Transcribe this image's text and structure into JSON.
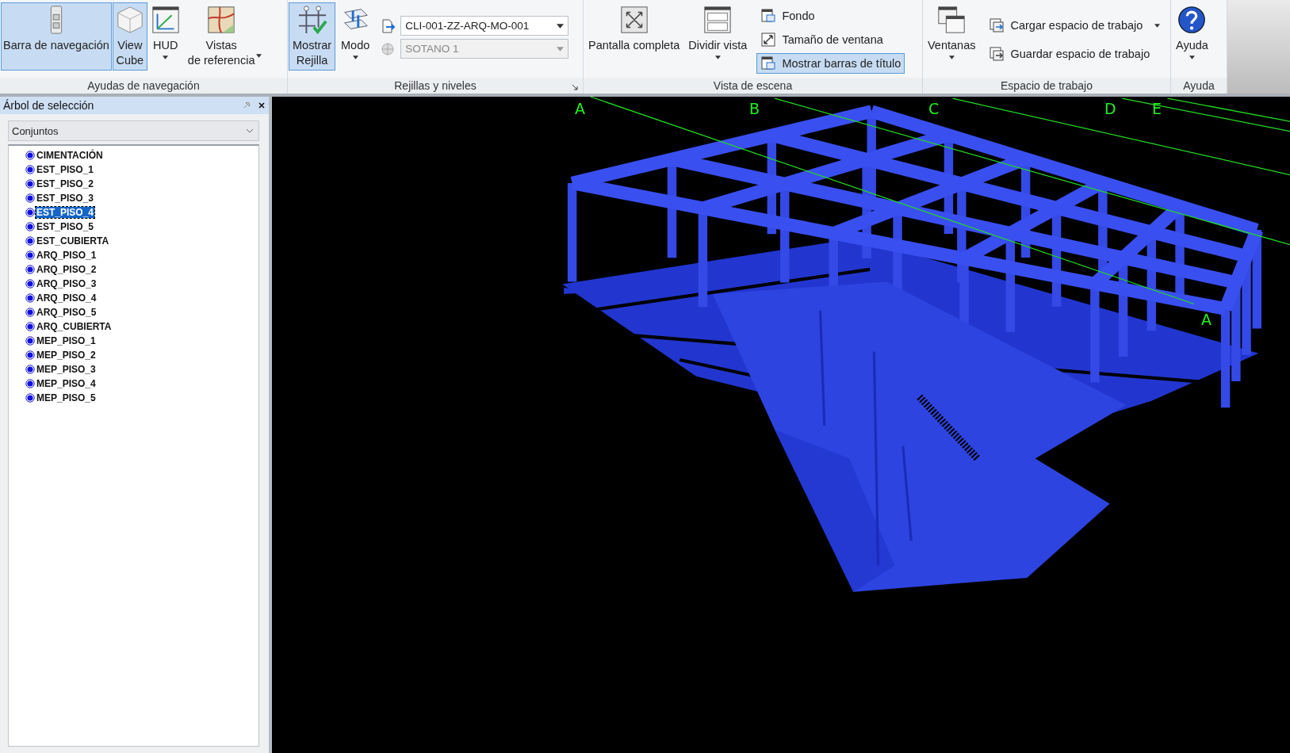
{
  "ribbon": {
    "groups": [
      {
        "label": "Ayudas de navegación",
        "large": [
          {
            "lines": [
              "Barra de navegación"
            ],
            "selected": true,
            "dropdown": false
          },
          {
            "lines": [
              "View",
              "Cube"
            ],
            "selected": true,
            "dropdown": false
          },
          {
            "lines": [
              "HUD"
            ],
            "selected": false,
            "dropdown": true
          },
          {
            "lines": [
              "Vistas",
              "de referencia"
            ],
            "selected": false,
            "dropdown": true
          }
        ]
      },
      {
        "label": "Rejillas y niveles",
        "launcher": true,
        "large": [
          {
            "lines": [
              "Mostrar",
              "Rejilla"
            ],
            "selected": true,
            "dropdown": false
          },
          {
            "lines": [
              "Modo"
            ],
            "selected": false,
            "dropdown": true
          }
        ],
        "combos": [
          {
            "value": "CLI-001-ZZ-ARQ-MO-001",
            "disabled": false
          },
          {
            "value": "SOTANO 1",
            "disabled": true
          }
        ]
      },
      {
        "label": "Vista de escena",
        "large": [
          {
            "lines": [
              "Pantalla completa"
            ],
            "selected": false,
            "dropdown": false
          },
          {
            "lines": [
              "Dividir vista"
            ],
            "selected": false,
            "dropdown": true
          }
        ],
        "small": [
          {
            "label": "Fondo",
            "selected": false,
            "dropdown": false
          },
          {
            "label": "Tamaño de ventana",
            "selected": false,
            "dropdown": false
          },
          {
            "label": "Mostrar barras de título",
            "selected": true,
            "dropdown": false
          }
        ]
      },
      {
        "label": "Espacio de trabajo",
        "large": [
          {
            "lines": [
              "Ventanas"
            ],
            "selected": false,
            "dropdown": true
          }
        ],
        "small": [
          {
            "label": "Cargar espacio de trabajo",
            "selected": false,
            "dropdown": true
          },
          {
            "label": "Guardar espacio de trabajo",
            "selected": false,
            "dropdown": false
          }
        ]
      },
      {
        "label": "Ayuda",
        "large": [
          {
            "lines": [
              "Ayuda"
            ],
            "selected": false,
            "dropdown": true
          }
        ]
      }
    ]
  },
  "panel": {
    "title": "Árbol de selección",
    "filter": {
      "value": "Conjuntos"
    },
    "items": [
      {
        "label": "CIMENTACIÓN",
        "selected": false
      },
      {
        "label": "EST_PISO_1",
        "selected": false
      },
      {
        "label": "EST_PISO_2",
        "selected": false
      },
      {
        "label": "EST_PISO_3",
        "selected": false
      },
      {
        "label": "EST_PISO_4",
        "selected": true
      },
      {
        "label": "EST_PISO_5",
        "selected": false
      },
      {
        "label": "EST_CUBIERTA",
        "selected": false
      },
      {
        "label": "ARQ_PISO_1",
        "selected": false
      },
      {
        "label": "ARQ_PISO_2",
        "selected": false
      },
      {
        "label": "ARQ_PISO_3",
        "selected": false
      },
      {
        "label": "ARQ_PISO_4",
        "selected": false
      },
      {
        "label": "ARQ_PISO_5",
        "selected": false
      },
      {
        "label": "ARQ_CUBIERTA",
        "selected": false
      },
      {
        "label": "MEP_PISO_1",
        "selected": false
      },
      {
        "label": "MEP_PISO_2",
        "selected": false
      },
      {
        "label": "MEP_PISO_3",
        "selected": false
      },
      {
        "label": "MEP_PISO_4",
        "selected": false
      },
      {
        "label": "MEP_PISO_5",
        "selected": false
      }
    ]
  },
  "viewport": {
    "grid_labels": [
      {
        "label": "A"
      },
      {
        "label": "B"
      },
      {
        "label": "C"
      },
      {
        "label": "D"
      },
      {
        "label": "E"
      },
      {
        "label": "A"
      }
    ]
  }
}
